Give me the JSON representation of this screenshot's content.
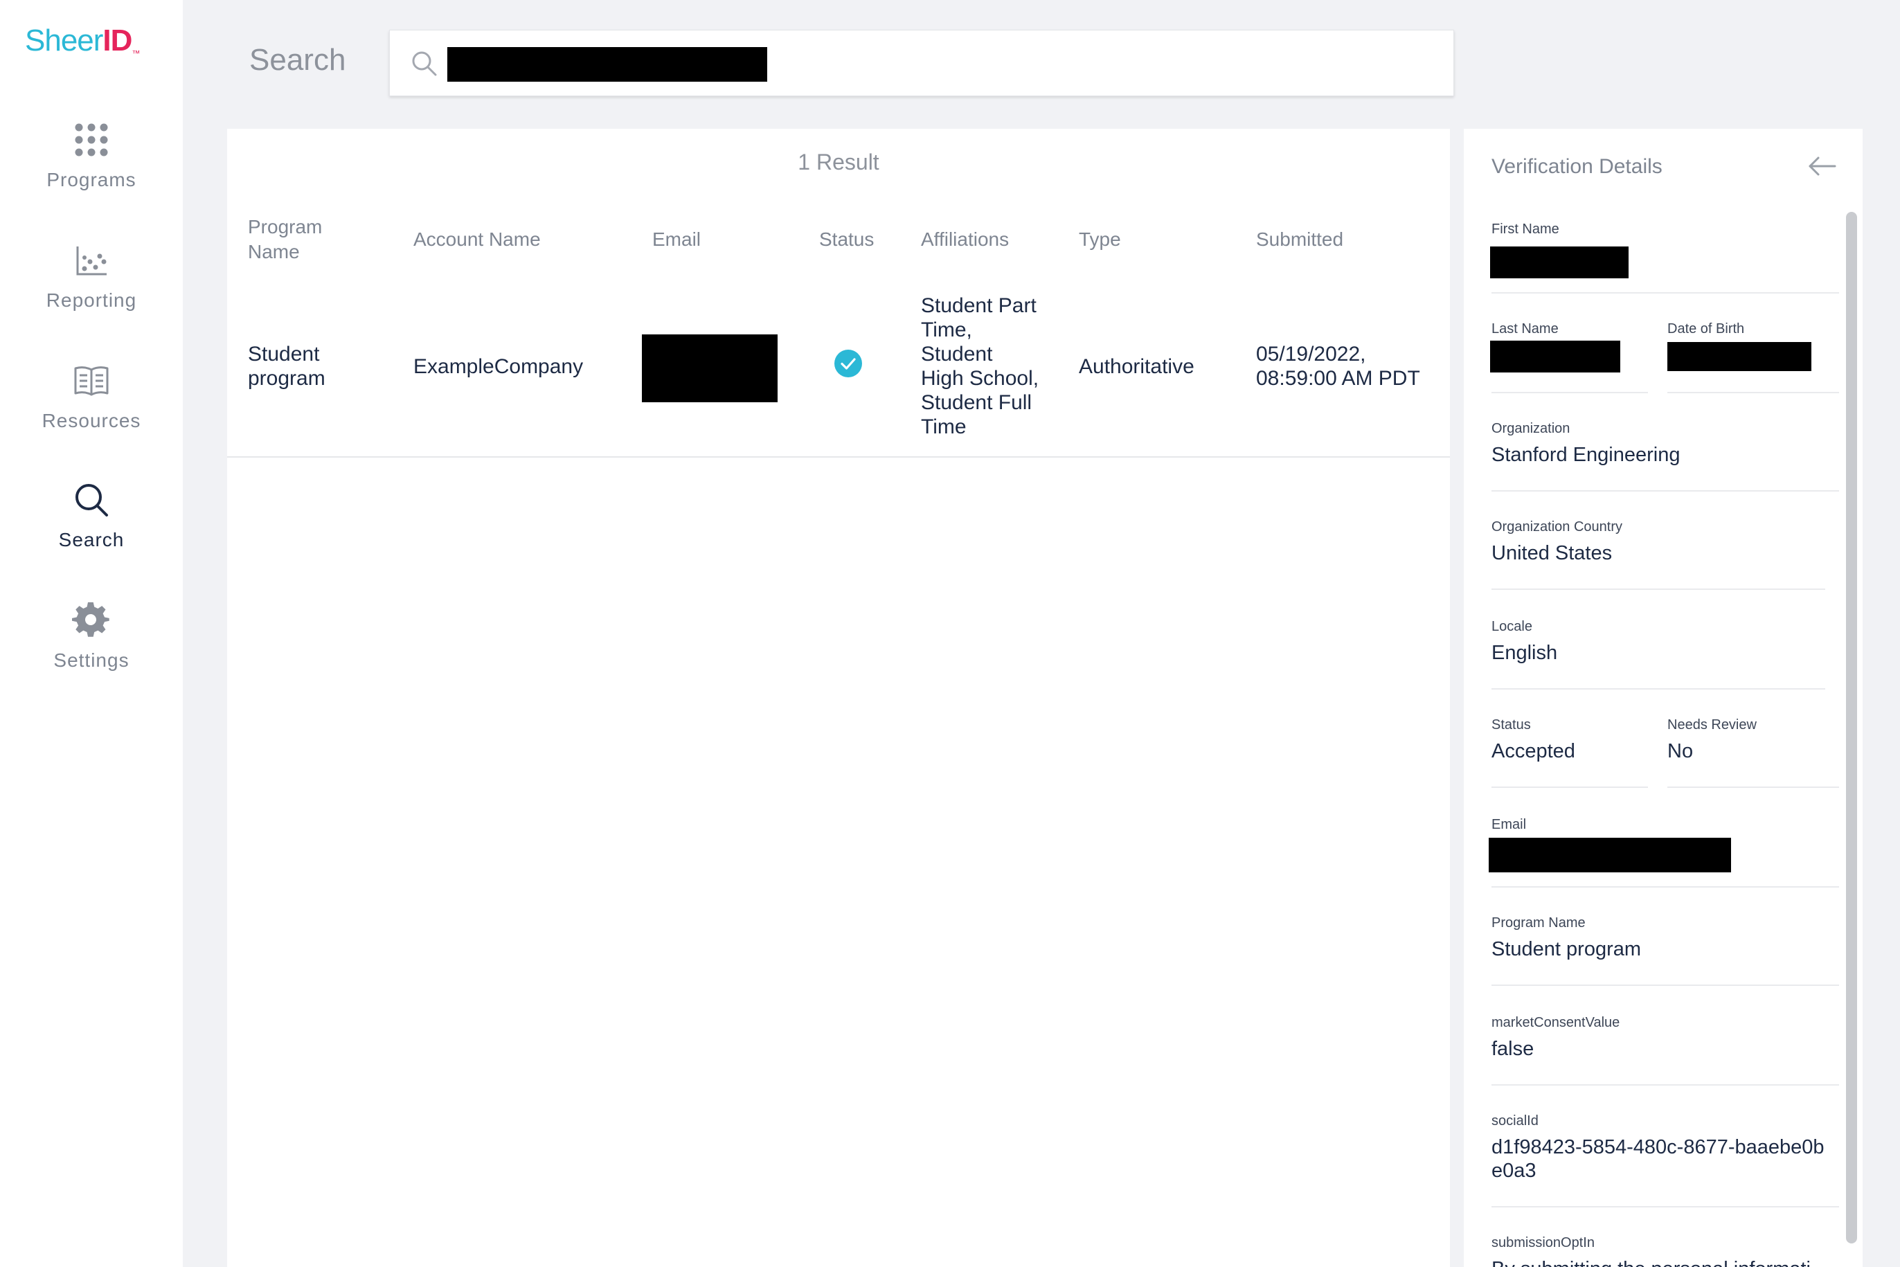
{
  "brand": {
    "logo_primary": "Sheer",
    "logo_secondary": "ID",
    "logo_tm": "™",
    "primary_color": "#2bb8d6",
    "accent_color": "#e5245b"
  },
  "sidebar": {
    "items": [
      {
        "label": "Programs",
        "icon": "grid-dots-icon"
      },
      {
        "label": "Reporting",
        "icon": "scatter-chart-icon"
      },
      {
        "label": "Resources",
        "icon": "open-book-icon"
      },
      {
        "label": "Search",
        "icon": "search-icon",
        "active": true
      },
      {
        "label": "Settings",
        "icon": "gear-icon"
      }
    ]
  },
  "search": {
    "title": "Search",
    "placeholder": ""
  },
  "results": {
    "count_label": "1 Result",
    "columns": [
      "Program\nName",
      "Account Name",
      "Email",
      "Status",
      "Affiliations",
      "Type",
      "Submitted"
    ],
    "rows": [
      {
        "program_name": "Student\nprogram",
        "account_name": "ExampleCompany",
        "email": "",
        "status": "accepted",
        "affiliations": "Student Part\nTime,\nStudent\nHigh School,\nStudent Full\nTime",
        "type": "Authoritative",
        "submitted": "05/19/2022,\n08:59:00 AM PDT"
      }
    ]
  },
  "details": {
    "title": "Verification Details",
    "fields": {
      "first_name_label": "First Name",
      "last_name_label": "Last Name",
      "dob_label": "Date of Birth",
      "organization_label": "Organization",
      "organization_value": "Stanford Engineering",
      "org_country_label": "Organization Country",
      "org_country_value": "United States",
      "locale_label": "Locale",
      "locale_value": "English",
      "status_label": "Status",
      "status_value": "Accepted",
      "needs_review_label": "Needs Review",
      "needs_review_value": "No",
      "email_label": "Email",
      "program_name_label": "Program Name",
      "program_name_value": "Student program",
      "market_consent_label": "marketConsentValue",
      "market_consent_value": "false",
      "social_id_label": "socialId",
      "social_id_value": "d1f98423-5854-480c-8677-baaebe0b\ne0a3",
      "submission_optin_label": "submissionOptIn",
      "submission_optin_value": "By submitting the personal informati"
    }
  },
  "colors": {
    "status_check": "#2bb8d6",
    "text_dark": "#1d2a44",
    "text_muted": "#7e8591"
  }
}
